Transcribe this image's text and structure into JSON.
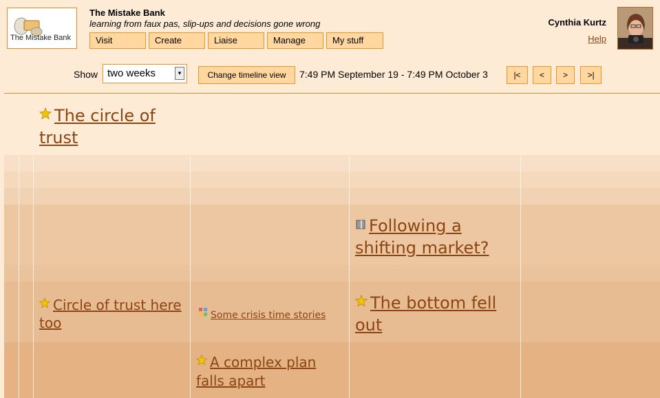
{
  "header": {
    "logo_text": "The Mistake Bank",
    "site_title": "The Mistake Bank",
    "tagline": "learning from faux pas, slip-ups and decisions gone wrong",
    "nav": [
      "Visit",
      "Create",
      "Liaise",
      "Manage",
      "My stuff"
    ],
    "user_name": "Cynthia Kurtz",
    "help_label": "Help"
  },
  "controls": {
    "show_label": "Show",
    "period_selected": "two weeks",
    "change_view_label": "Change timeline view",
    "range_text": "7:49 PM September 19 - 7:49 PM October 3",
    "pager": [
      "|<",
      "<",
      ">",
      ">|"
    ]
  },
  "stories": {
    "s1": "The circle of trust",
    "s2": "Following a shifting market?",
    "s3": "Circle of trust here too",
    "s4": "Some crisis time stories",
    "s5": "The bottom fell out",
    "s6": "A complex plan falls apart"
  },
  "icons": {
    "s1": "star-icon",
    "s2": "book-icon",
    "s3": "star-icon",
    "s4": "collage-icon",
    "s5": "star-icon",
    "s6": "star-icon"
  },
  "colors": {
    "background": "#fdebd6",
    "button_bg": "#ffd79f",
    "button_border": "#e8952f",
    "link": "#8b4513"
  }
}
